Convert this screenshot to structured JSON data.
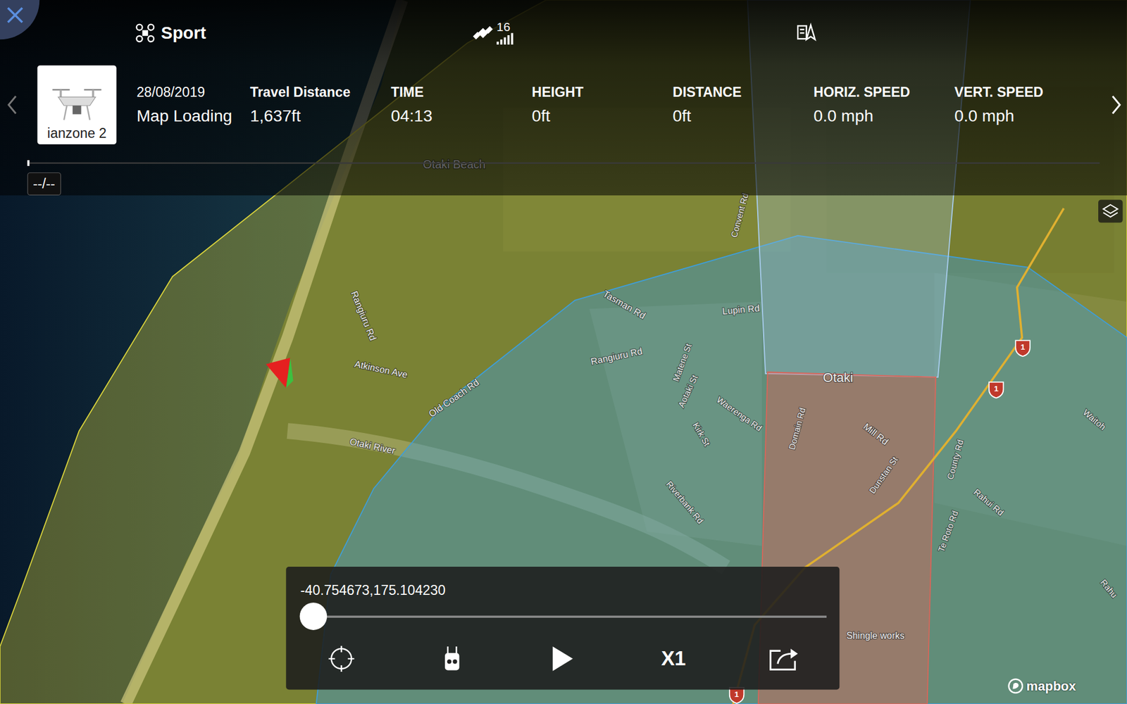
{
  "header": {
    "mode": "Sport",
    "satellites": "16",
    "signal_level": 1
  },
  "aircraft": {
    "name": "ianzone 2"
  },
  "flight": {
    "date": "28/08/2019",
    "status": "Map Loading"
  },
  "stats": [
    {
      "label": "Travel Distance",
      "value": "1,637ft"
    },
    {
      "label": "TIME",
      "value": "04:13"
    },
    {
      "label": "HEIGHT",
      "value": "0ft"
    },
    {
      "label": "DISTANCE",
      "value": "0ft"
    },
    {
      "label": "HORIZ. SPEED",
      "value": "0.0 mph"
    },
    {
      "label": "VERT. SPEED",
      "value": "0.0 mph"
    }
  ],
  "timeline": {
    "level": 0,
    "marker": "--/--"
  },
  "map": {
    "zones": [
      {
        "color": "#d8d23c"
      },
      {
        "color": "#3f9ed8"
      },
      {
        "color": "#a8cdee"
      },
      {
        "color": "#d8665a"
      }
    ],
    "labels": [
      "Otaki Beach",
      "Convent Rd",
      "Rangiuru Rd",
      "Atkinson Ave",
      "Old Coach Rd",
      "Otaki River",
      "Tasman Rd",
      "Lupin Rd",
      "Rangiuru Rd",
      "Matene St",
      "Aotaki St",
      "Waerenga Rd",
      "Kirk St",
      "Riverbank Rd",
      "Otaki",
      "Domain Rd",
      "Mill Rd",
      "Dunstan St",
      "County Rd",
      "Rahui Rd",
      "Te Roto Rd",
      "Shingle works",
      "Waitoh",
      "Rahu"
    ],
    "shields": [
      "1",
      "1",
      "1"
    ],
    "attribution": "mapbox"
  },
  "player": {
    "coordinates": "-40.754673,175.104230",
    "level": 0,
    "speed": "X1"
  }
}
